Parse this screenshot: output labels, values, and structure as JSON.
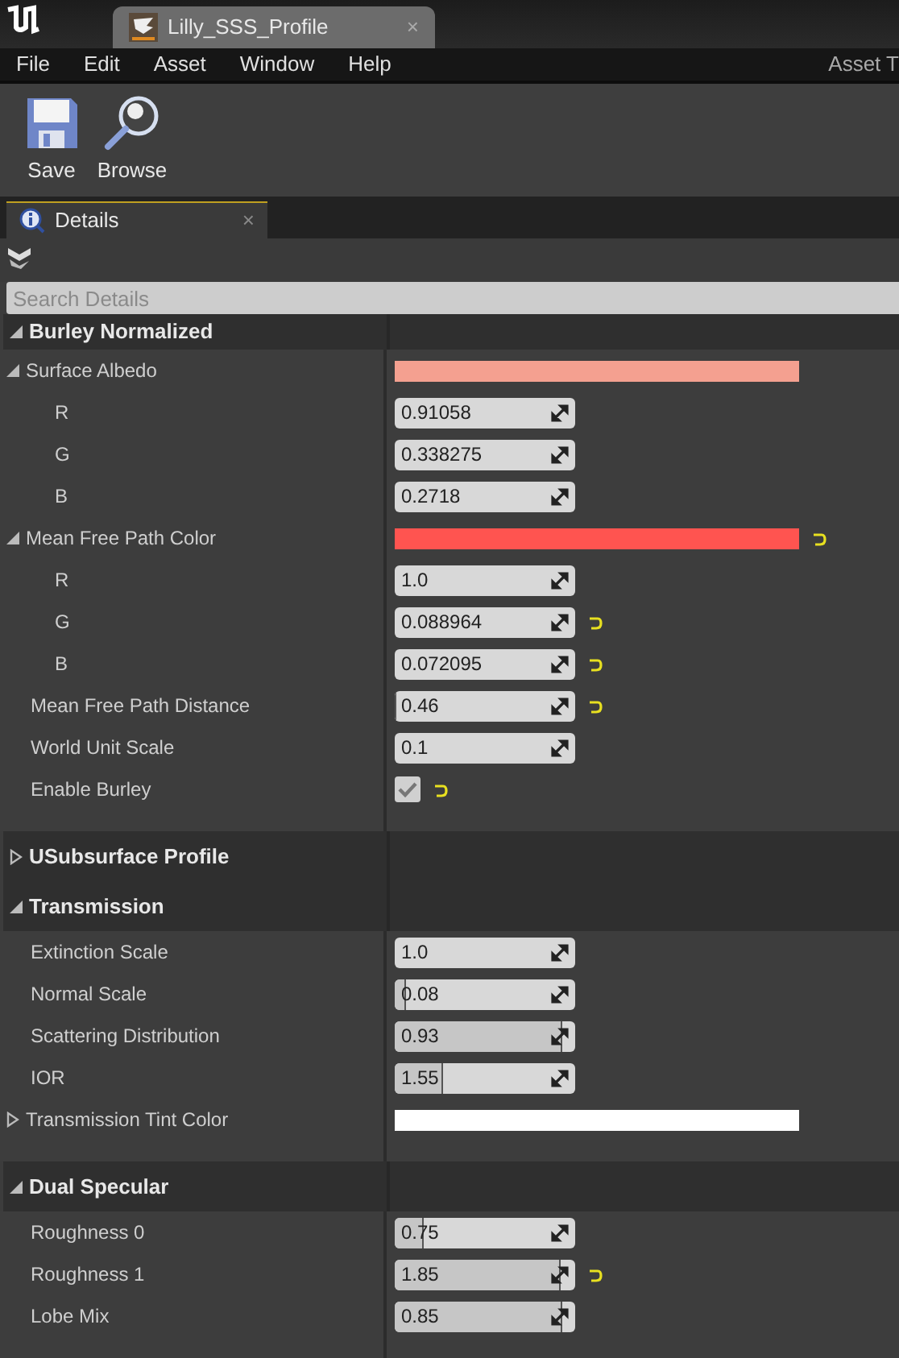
{
  "document_tab": {
    "title": "Lilly_SSS_Profile",
    "close": "×"
  },
  "menu": [
    "File",
    "Edit",
    "Asset",
    "Window",
    "Help"
  ],
  "menu_right": "Asset T",
  "toolbar": [
    {
      "kind": "save",
      "label": "Save"
    },
    {
      "kind": "browse",
      "label": "Browse"
    }
  ],
  "panel_tab": {
    "title": "Details",
    "close": "×"
  },
  "search": {
    "placeholder": "Search Details"
  },
  "sections": [
    {
      "title": "Burley Normalized",
      "expanded": true,
      "rows": [
        {
          "label": "Surface Albedo",
          "kind": "color",
          "color": "#f4a090",
          "expanded": true,
          "modified": false,
          "children": [
            {
              "label": "R",
              "kind": "number",
              "value": "0.91058",
              "modified": false
            },
            {
              "label": "G",
              "kind": "number",
              "value": "0.338275",
              "modified": false
            },
            {
              "label": "B",
              "kind": "number",
              "value": "0.2718",
              "modified": false
            }
          ]
        },
        {
          "label": "Mean Free Path Color",
          "kind": "color",
          "color": "#ff5450",
          "expanded": true,
          "modified": true,
          "children": [
            {
              "label": "R",
              "kind": "number",
              "value": "1.0",
              "modified": false
            },
            {
              "label": "G",
              "kind": "number",
              "value": "0.088964",
              "modified": true
            },
            {
              "label": "B",
              "kind": "number",
              "value": "0.072095",
              "modified": true
            }
          ]
        },
        {
          "label": "Mean Free Path Distance",
          "kind": "number",
          "value": "0.46",
          "level": 0,
          "modified": true
        },
        {
          "label": "World Unit Scale",
          "kind": "number",
          "value": "0.1",
          "modified": false
        },
        {
          "label": "Enable Burley",
          "kind": "check",
          "checked": true,
          "modified": true
        }
      ]
    },
    {
      "title": "USubsurface Profile",
      "expanded": false
    },
    {
      "title": "Transmission",
      "expanded": true,
      "rows": [
        {
          "label": "Extinction Scale",
          "kind": "number",
          "value": "1.0",
          "modified": false
        },
        {
          "label": "Normal Scale",
          "kind": "number",
          "value": "0.08",
          "level": 0.06,
          "modified": false
        },
        {
          "label": "Scattering Distribution",
          "kind": "number",
          "value": "0.93",
          "level": 0.93,
          "modified": false
        },
        {
          "label": "IOR",
          "kind": "number",
          "value": "1.55",
          "level": 0.27,
          "modified": false
        },
        {
          "label": "Transmission Tint Color",
          "kind": "color",
          "color": "#ffffff",
          "expanded": false,
          "modified": false
        }
      ]
    },
    {
      "title": "Dual Specular",
      "expanded": true,
      "rows": [
        {
          "label": "Roughness 0",
          "kind": "number",
          "value": "0.75",
          "level": 0.16,
          "modified": false
        },
        {
          "label": "Roughness 1",
          "kind": "number",
          "value": "1.85",
          "level": 0.92,
          "modified": true
        },
        {
          "label": "Lobe Mix",
          "kind": "number",
          "value": "0.85",
          "level": 0.93,
          "modified": false
        }
      ]
    }
  ]
}
